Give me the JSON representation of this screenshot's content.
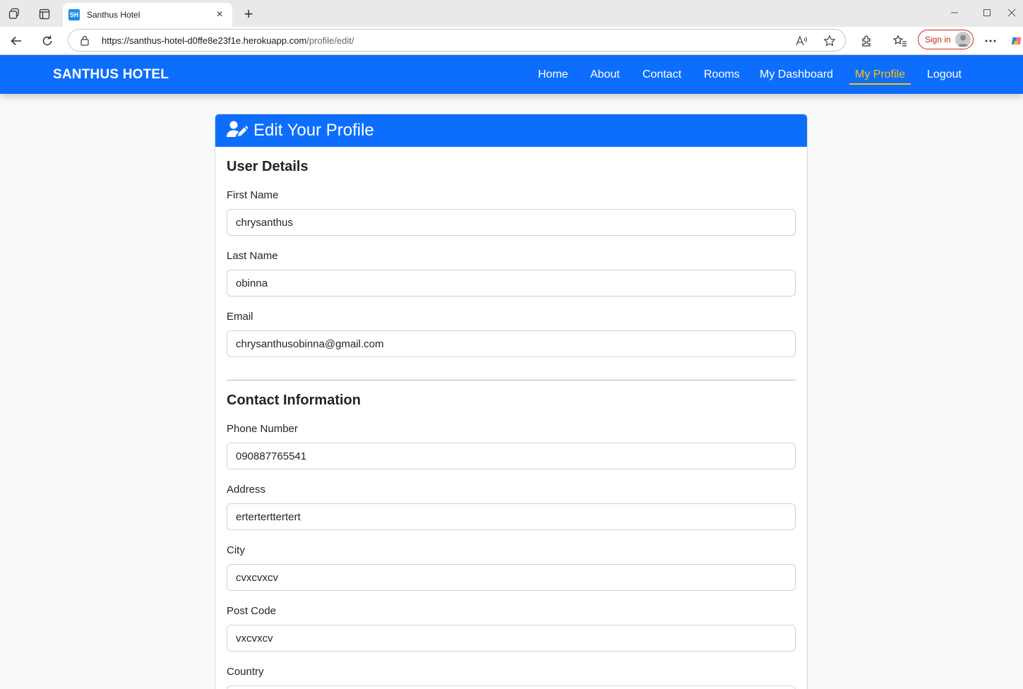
{
  "browser": {
    "tab_title": "Santhus Hotel",
    "favicon_text": "SH",
    "url_host": "https://santhus-hotel-d0ffe8e23f1e.herokuapp.com",
    "url_path": "/profile/edit/",
    "signin_label": "Sign in"
  },
  "navbar": {
    "brand": "SANTHUS HOTEL",
    "links": [
      "Home",
      "About",
      "Contact",
      "Rooms",
      "My Dashboard",
      "My Profile",
      "Logout"
    ],
    "active": "My Profile",
    "bg_color": "#0d6efd",
    "active_color": "#ffc107"
  },
  "card": {
    "title": "Edit Your Profile",
    "title_icon": "user-edit-icon"
  },
  "user_details": {
    "heading": "User Details",
    "first_name": {
      "label": "First Name",
      "value": "chrysanthus"
    },
    "last_name": {
      "label": "Last Name",
      "value": "obinna"
    },
    "email": {
      "label": "Email",
      "value": "chrysanthusobinna@gmail.com"
    }
  },
  "contact_info": {
    "heading": "Contact Information",
    "phone": {
      "label": "Phone Number",
      "value": "090887765541"
    },
    "address": {
      "label": "Address",
      "value": "erterterttertert"
    },
    "city": {
      "label": "City",
      "value": "cvxcvxcv"
    },
    "post_code": {
      "label": "Post Code",
      "value": "vxcvxcv"
    },
    "country": {
      "label": "Country",
      "value": ""
    }
  }
}
